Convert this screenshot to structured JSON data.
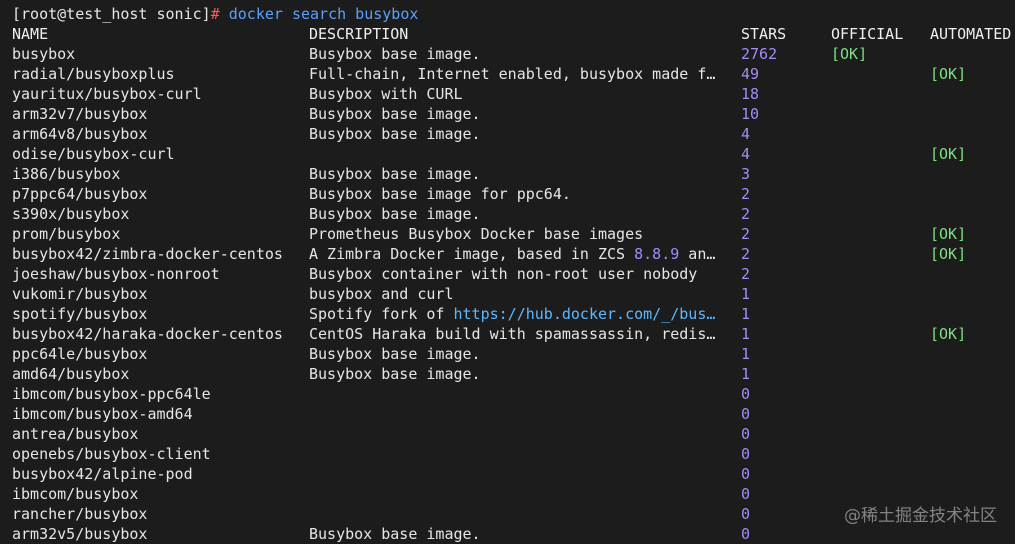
{
  "prompt": {
    "user_host": "[root@test_host sonic]",
    "hash": "#",
    "command": " docker search busybox"
  },
  "headers": {
    "name": "NAME",
    "description": "DESCRIPTION",
    "stars": "STARS",
    "official": "OFFICIAL",
    "automated": "AUTOMATED"
  },
  "rows": [
    {
      "name": "busybox",
      "desc": "Busybox base image.",
      "stars": "2762",
      "official": "[OK]",
      "automated": ""
    },
    {
      "name": "radial/busyboxplus",
      "desc": "Full-chain, Internet enabled, busybox made f…",
      "stars": "49",
      "official": "",
      "automated": "[OK]"
    },
    {
      "name": "yauritux/busybox-curl",
      "desc": "Busybox with CURL",
      "stars": "18",
      "official": "",
      "automated": ""
    },
    {
      "name": "arm32v7/busybox",
      "desc": "Busybox base image.",
      "stars": "10",
      "official": "",
      "automated": ""
    },
    {
      "name": "arm64v8/busybox",
      "desc": "Busybox base image.",
      "stars": "4",
      "official": "",
      "automated": ""
    },
    {
      "name": "odise/busybox-curl",
      "desc": "",
      "stars": "4",
      "official": "",
      "automated": "[OK]"
    },
    {
      "name": "i386/busybox",
      "desc": "Busybox base image.",
      "stars": "3",
      "official": "",
      "automated": ""
    },
    {
      "name": "p7ppc64/busybox",
      "desc": "Busybox base image for ppc64.",
      "stars": "2",
      "official": "",
      "automated": ""
    },
    {
      "name": "s390x/busybox",
      "desc": "Busybox base image.",
      "stars": "2",
      "official": "",
      "automated": ""
    },
    {
      "name": "prom/busybox",
      "desc": "Prometheus Busybox Docker base images",
      "stars": "2",
      "official": "",
      "automated": "[OK]"
    },
    {
      "name": "busybox42/zimbra-docker-centos",
      "desc_pre": "A Zimbra Docker image, based in ZCS ",
      "desc_num": "8.8.9",
      "desc_post": " an…",
      "stars": "2",
      "official": "",
      "automated": "[OK]"
    },
    {
      "name": "joeshaw/busybox-nonroot",
      "desc": "Busybox container with non-root user nobody",
      "stars": "2",
      "official": "",
      "automated": ""
    },
    {
      "name": "vukomir/busybox",
      "desc": "busybox and curl",
      "stars": "1",
      "official": "",
      "automated": ""
    },
    {
      "name": "spotify/busybox",
      "desc_pre": "Spotify fork of ",
      "desc_url": "https://hub.docker.com/_/bus…",
      "stars": "1",
      "official": "",
      "automated": ""
    },
    {
      "name": "busybox42/haraka-docker-centos",
      "desc": "CentOS Haraka build with spamassassin, redis…",
      "stars": "1",
      "official": "",
      "automated": "[OK]"
    },
    {
      "name": "ppc64le/busybox",
      "desc": "Busybox base image.",
      "stars": "1",
      "official": "",
      "automated": ""
    },
    {
      "name": "amd64/busybox",
      "desc": "Busybox base image.",
      "stars": "1",
      "official": "",
      "automated": ""
    },
    {
      "name": "ibmcom/busybox-ppc64le",
      "desc": "",
      "stars": "0",
      "official": "",
      "automated": ""
    },
    {
      "name": "ibmcom/busybox-amd64",
      "desc": "",
      "stars": "0",
      "official": "",
      "automated": ""
    },
    {
      "name": "antrea/busybox",
      "desc": "",
      "stars": "0",
      "official": "",
      "automated": ""
    },
    {
      "name": "openebs/busybox-client",
      "desc": "",
      "stars": "0",
      "official": "",
      "automated": ""
    },
    {
      "name": "busybox42/alpine-pod",
      "desc": "",
      "stars": "0",
      "official": "",
      "automated": ""
    },
    {
      "name": "ibmcom/busybox",
      "desc": "",
      "stars": "0",
      "official": "",
      "automated": ""
    },
    {
      "name": "rancher/busybox",
      "desc": "",
      "stars": "0",
      "official": "",
      "automated": ""
    },
    {
      "name": "arm32v5/busybox",
      "desc": "Busybox base image.",
      "stars": "0",
      "official": "",
      "automated": ""
    }
  ],
  "watermark": "@稀土掘金技术社区",
  "colors": {
    "background": "#1c1c1c",
    "text": "#e6e6e6",
    "stars": "#a78bfa",
    "ok": "#7ee07e",
    "command": "#5aa0ff",
    "url": "#5cb8ff"
  }
}
